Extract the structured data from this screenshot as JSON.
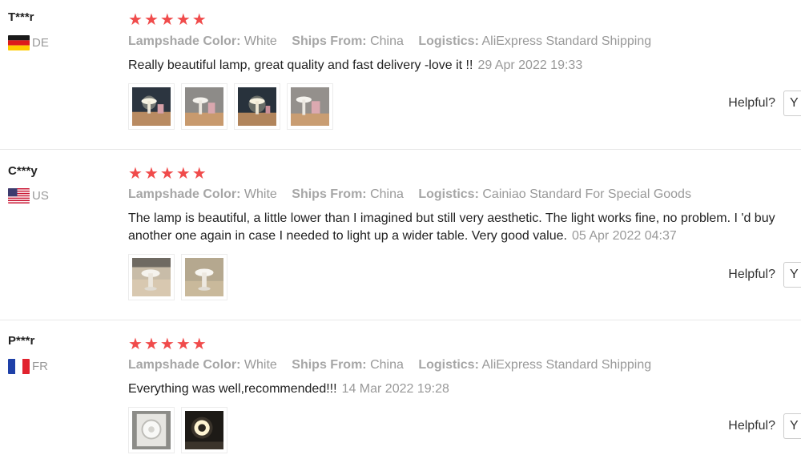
{
  "reviews": [
    {
      "user": "T***r",
      "country_code": "DE",
      "flag": "germany-flag",
      "stars": 5,
      "attributes": [
        {
          "key": "Lampshade Color:",
          "value": "White"
        },
        {
          "key": "Ships From:",
          "value": "China"
        },
        {
          "key": "Logistics:",
          "value": "AliExpress Standard Shipping"
        }
      ],
      "text": "Really beautiful lamp, great quality and fast delivery -love it !!",
      "date": "29 Apr 2022 19:33",
      "photo_count": 4,
      "helpful_label": "Helpful?",
      "yes_label": "Y"
    },
    {
      "user": "C***y",
      "country_code": "US",
      "flag": "usa-flag",
      "stars": 5,
      "attributes": [
        {
          "key": "Lampshade Color:",
          "value": "White"
        },
        {
          "key": "Ships From:",
          "value": "China"
        },
        {
          "key": "Logistics:",
          "value": "Cainiao Standard For Special Goods"
        }
      ],
      "text": "The lamp is beautiful, a little lower than I imagined but still very aesthetic. The light works fine, no problem. I 'd buy another one again in case I needed to light up a wider table. Very good value.",
      "date": "05 Apr 2022 04:37",
      "photo_count": 2,
      "helpful_label": "Helpful?",
      "yes_label": "Y"
    },
    {
      "user": "P***r",
      "country_code": "FR",
      "flag": "france-flag",
      "stars": 5,
      "attributes": [
        {
          "key": "Lampshade Color:",
          "value": "White"
        },
        {
          "key": "Ships From:",
          "value": "China"
        },
        {
          "key": "Logistics:",
          "value": "AliExpress Standard Shipping"
        }
      ],
      "text": "Everything was well,recommended!!!",
      "date": "14 Mar 2022 19:28",
      "photo_count": 2,
      "helpful_label": "Helpful?",
      "yes_label": "Y"
    }
  ],
  "colors": {
    "star": "#f04b4b",
    "muted_text": "#999999",
    "divider": "#e8e8e8"
  }
}
